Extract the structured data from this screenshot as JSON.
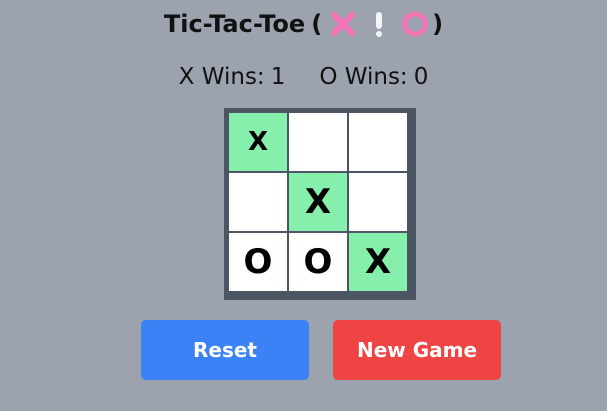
{
  "header": {
    "title": "Tic-Tac-Toe",
    "open_paren": "(",
    "close_paren": ")",
    "icons": [
      "cross-mark-icon",
      "exclamation-icon",
      "circle-icon"
    ]
  },
  "scoreboard": {
    "x_label": "X Wins:",
    "x_wins": "1",
    "o_label": "O Wins:",
    "o_wins": "0"
  },
  "board": {
    "cells": [
      "X",
      "",
      "",
      "",
      "X",
      "",
      "O",
      "O",
      "X"
    ],
    "winning_cells": [
      0,
      4,
      8
    ]
  },
  "buttons": {
    "reset": "Reset",
    "new_game": "New Game"
  },
  "colors": {
    "background": "#9ca3af",
    "winning_cell": "#86efac",
    "reset_button": "#3b82f6",
    "new_game_button": "#ef4444",
    "cross_icon": "#f472b6",
    "circle_icon": "#f472b6"
  }
}
